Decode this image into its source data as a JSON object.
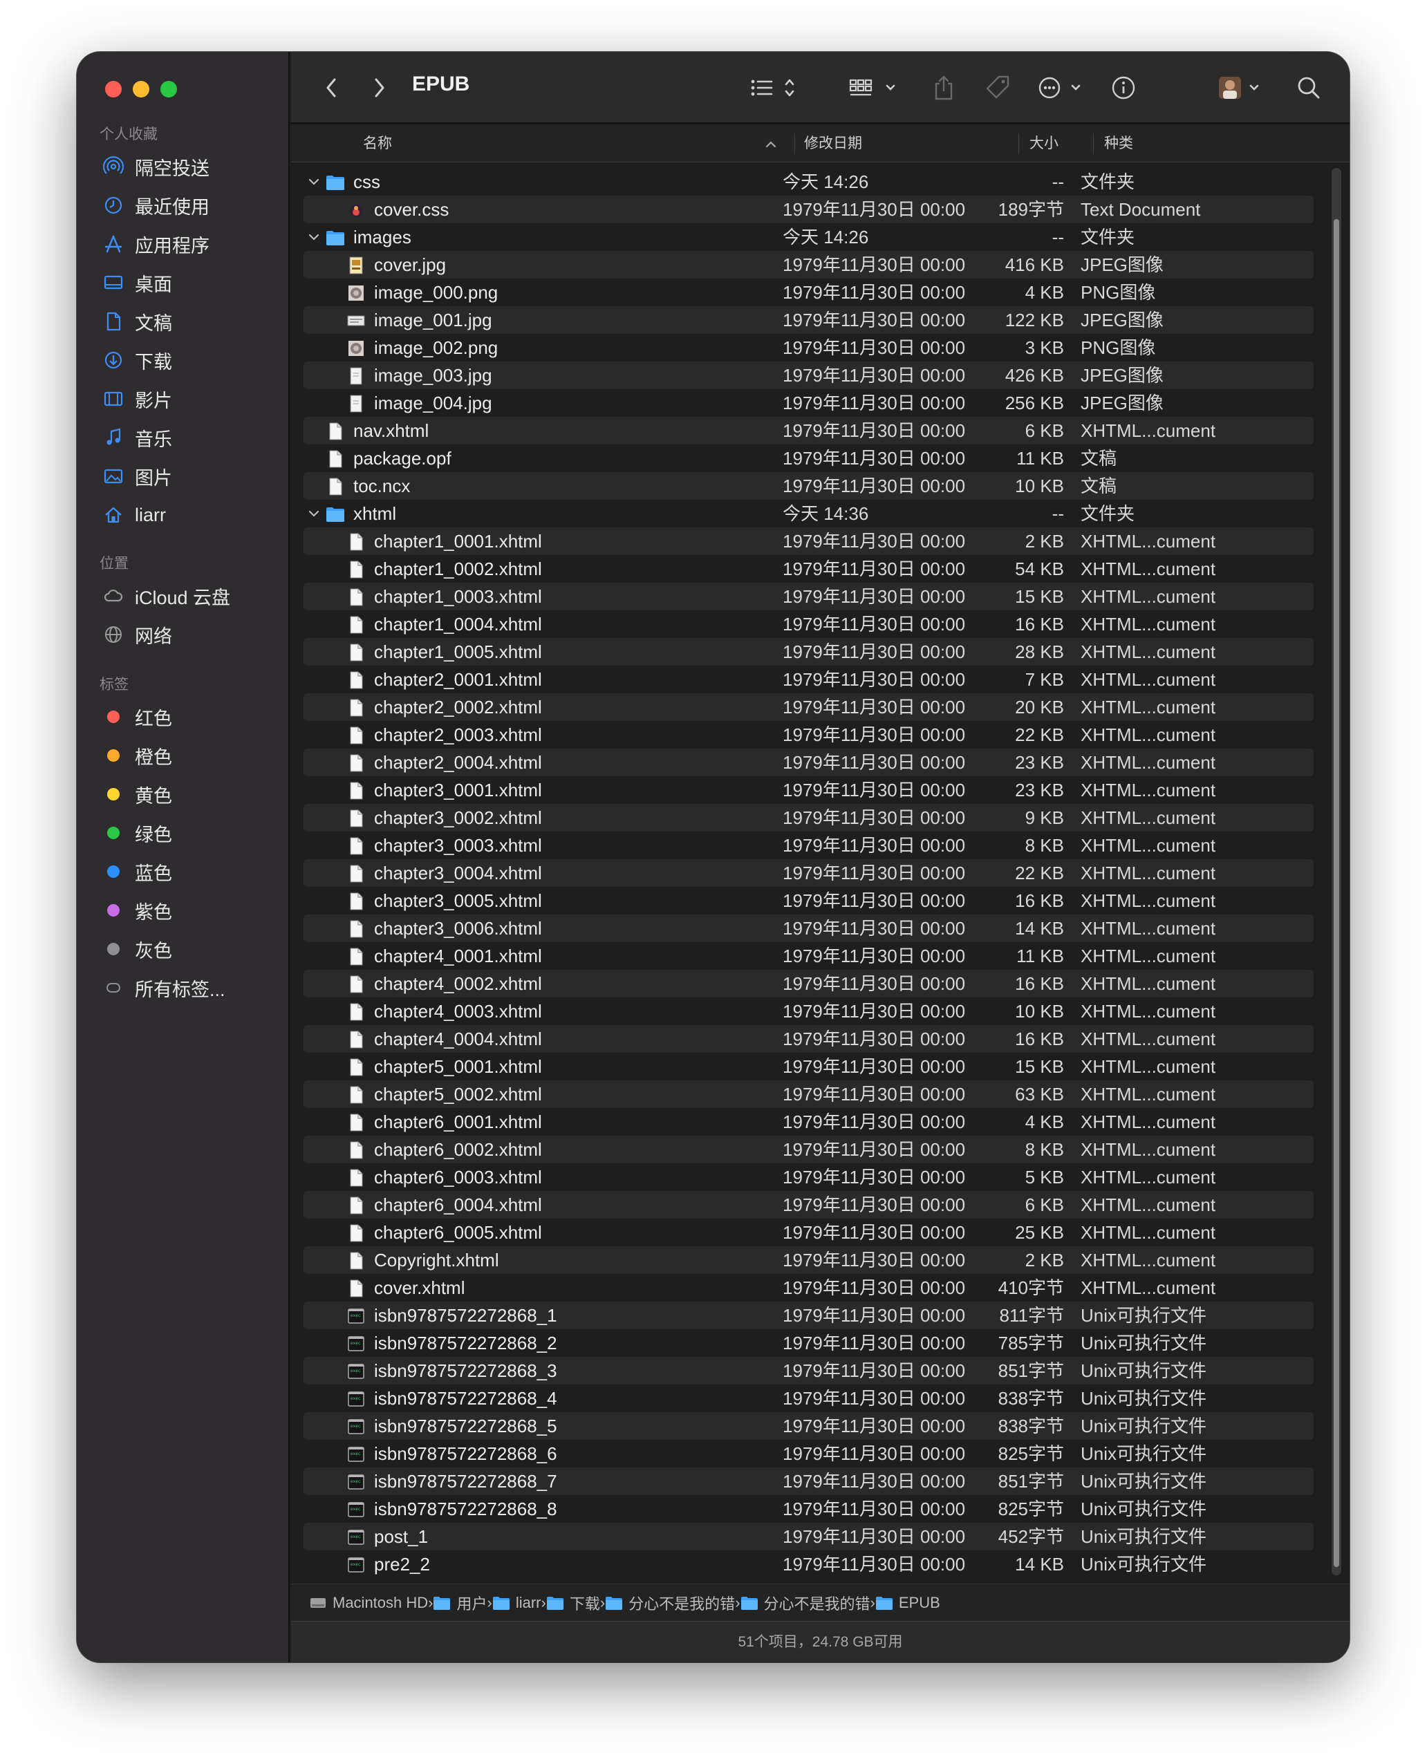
{
  "window_title": "EPUB",
  "sidebar": {
    "favorites_header": "个人收藏",
    "favorites": [
      {
        "label": "隔空投送",
        "icon": "airdrop-icon"
      },
      {
        "label": "最近使用",
        "icon": "clock-icon"
      },
      {
        "label": "应用程序",
        "icon": "applications-icon"
      },
      {
        "label": "桌面",
        "icon": "desktop-icon"
      },
      {
        "label": "文稿",
        "icon": "document-icon"
      },
      {
        "label": "下载",
        "icon": "download-icon"
      },
      {
        "label": "影片",
        "icon": "film-icon"
      },
      {
        "label": "音乐",
        "icon": "music-icon"
      },
      {
        "label": "图片",
        "icon": "photo-icon"
      },
      {
        "label": "liarr",
        "icon": "home-icon"
      }
    ],
    "locations_header": "位置",
    "locations": [
      {
        "label": "iCloud 云盘",
        "icon": "icloud-icon"
      },
      {
        "label": "网络",
        "icon": "network-icon"
      }
    ],
    "tags_header": "标签",
    "tags": [
      {
        "label": "红色",
        "color": "#fe5f57"
      },
      {
        "label": "橙色",
        "color": "#fdaa2c"
      },
      {
        "label": "黄色",
        "color": "#fdd62f"
      },
      {
        "label": "绿色",
        "color": "#2ac846"
      },
      {
        "label": "蓝色",
        "color": "#2d8fff"
      },
      {
        "label": "紫色",
        "color": "#c86ce8"
      },
      {
        "label": "灰色",
        "color": "#8e8e93"
      },
      {
        "label": "所有标签...",
        "color": ""
      }
    ]
  },
  "columns": {
    "name": "名称",
    "date": "修改日期",
    "size": "大小",
    "kind": "种类"
  },
  "files": [
    {
      "name": "css",
      "date": "今天 14:26",
      "size": "--",
      "kind": "文件夹",
      "level": 0,
      "icon": "folder-icon",
      "expanded": true
    },
    {
      "name": "cover.css",
      "date": "1979年11月30日 00:00",
      "size": "189字节",
      "kind": "Text Document",
      "level": 1,
      "icon": "css-file-icon"
    },
    {
      "name": "images",
      "date": "今天 14:26",
      "size": "--",
      "kind": "文件夹",
      "level": 0,
      "icon": "folder-icon",
      "expanded": true
    },
    {
      "name": "cover.jpg",
      "date": "1979年11月30日 00:00",
      "size": "416 KB",
      "kind": "JPEG图像",
      "level": 1,
      "icon": "image-thumb-icon"
    },
    {
      "name": "image_000.png",
      "date": "1979年11月30日 00:00",
      "size": "4 KB",
      "kind": "PNG图像",
      "level": 1,
      "icon": "image-thumb-icon"
    },
    {
      "name": "image_001.jpg",
      "date": "1979年11月30日 00:00",
      "size": "122 KB",
      "kind": "JPEG图像",
      "level": 1,
      "icon": "image-thumb-icon"
    },
    {
      "name": "image_002.png",
      "date": "1979年11月30日 00:00",
      "size": "3 KB",
      "kind": "PNG图像",
      "level": 1,
      "icon": "image-thumb-icon"
    },
    {
      "name": "image_003.jpg",
      "date": "1979年11月30日 00:00",
      "size": "426 KB",
      "kind": "JPEG图像",
      "level": 1,
      "icon": "image-thumb-icon"
    },
    {
      "name": "image_004.jpg",
      "date": "1979年11月30日 00:00",
      "size": "256 KB",
      "kind": "JPEG图像",
      "level": 1,
      "icon": "image-thumb-icon"
    },
    {
      "name": "nav.xhtml",
      "date": "1979年11月30日 00:00",
      "size": "6 KB",
      "kind": "XHTML...cument",
      "level": 0,
      "icon": "document-file-icon"
    },
    {
      "name": "package.opf",
      "date": "1979年11月30日 00:00",
      "size": "11 KB",
      "kind": "文稿",
      "level": 0,
      "icon": "document-file-icon"
    },
    {
      "name": "toc.ncx",
      "date": "1979年11月30日 00:00",
      "size": "10 KB",
      "kind": "文稿",
      "level": 0,
      "icon": "document-file-icon"
    },
    {
      "name": "xhtml",
      "date": "今天 14:36",
      "size": "--",
      "kind": "文件夹",
      "level": 0,
      "icon": "folder-icon",
      "expanded": true
    },
    {
      "name": "chapter1_0001.xhtml",
      "date": "1979年11月30日 00:00",
      "size": "2 KB",
      "kind": "XHTML...cument",
      "level": 1,
      "icon": "document-file-icon"
    },
    {
      "name": "chapter1_0002.xhtml",
      "date": "1979年11月30日 00:00",
      "size": "54 KB",
      "kind": "XHTML...cument",
      "level": 1,
      "icon": "document-file-icon"
    },
    {
      "name": "chapter1_0003.xhtml",
      "date": "1979年11月30日 00:00",
      "size": "15 KB",
      "kind": "XHTML...cument",
      "level": 1,
      "icon": "document-file-icon"
    },
    {
      "name": "chapter1_0004.xhtml",
      "date": "1979年11月30日 00:00",
      "size": "16 KB",
      "kind": "XHTML...cument",
      "level": 1,
      "icon": "document-file-icon"
    },
    {
      "name": "chapter1_0005.xhtml",
      "date": "1979年11月30日 00:00",
      "size": "28 KB",
      "kind": "XHTML...cument",
      "level": 1,
      "icon": "document-file-icon"
    },
    {
      "name": "chapter2_0001.xhtml",
      "date": "1979年11月30日 00:00",
      "size": "7 KB",
      "kind": "XHTML...cument",
      "level": 1,
      "icon": "document-file-icon"
    },
    {
      "name": "chapter2_0002.xhtml",
      "date": "1979年11月30日 00:00",
      "size": "20 KB",
      "kind": "XHTML...cument",
      "level": 1,
      "icon": "document-file-icon"
    },
    {
      "name": "chapter2_0003.xhtml",
      "date": "1979年11月30日 00:00",
      "size": "22 KB",
      "kind": "XHTML...cument",
      "level": 1,
      "icon": "document-file-icon"
    },
    {
      "name": "chapter2_0004.xhtml",
      "date": "1979年11月30日 00:00",
      "size": "23 KB",
      "kind": "XHTML...cument",
      "level": 1,
      "icon": "document-file-icon"
    },
    {
      "name": "chapter3_0001.xhtml",
      "date": "1979年11月30日 00:00",
      "size": "23 KB",
      "kind": "XHTML...cument",
      "level": 1,
      "icon": "document-file-icon"
    },
    {
      "name": "chapter3_0002.xhtml",
      "date": "1979年11月30日 00:00",
      "size": "9 KB",
      "kind": "XHTML...cument",
      "level": 1,
      "icon": "document-file-icon"
    },
    {
      "name": "chapter3_0003.xhtml",
      "date": "1979年11月30日 00:00",
      "size": "8 KB",
      "kind": "XHTML...cument",
      "level": 1,
      "icon": "document-file-icon"
    },
    {
      "name": "chapter3_0004.xhtml",
      "date": "1979年11月30日 00:00",
      "size": "22 KB",
      "kind": "XHTML...cument",
      "level": 1,
      "icon": "document-file-icon"
    },
    {
      "name": "chapter3_0005.xhtml",
      "date": "1979年11月30日 00:00",
      "size": "16 KB",
      "kind": "XHTML...cument",
      "level": 1,
      "icon": "document-file-icon"
    },
    {
      "name": "chapter3_0006.xhtml",
      "date": "1979年11月30日 00:00",
      "size": "14 KB",
      "kind": "XHTML...cument",
      "level": 1,
      "icon": "document-file-icon"
    },
    {
      "name": "chapter4_0001.xhtml",
      "date": "1979年11月30日 00:00",
      "size": "11 KB",
      "kind": "XHTML...cument",
      "level": 1,
      "icon": "document-file-icon"
    },
    {
      "name": "chapter4_0002.xhtml",
      "date": "1979年11月30日 00:00",
      "size": "16 KB",
      "kind": "XHTML...cument",
      "level": 1,
      "icon": "document-file-icon"
    },
    {
      "name": "chapter4_0003.xhtml",
      "date": "1979年11月30日 00:00",
      "size": "10 KB",
      "kind": "XHTML...cument",
      "level": 1,
      "icon": "document-file-icon"
    },
    {
      "name": "chapter4_0004.xhtml",
      "date": "1979年11月30日 00:00",
      "size": "16 KB",
      "kind": "XHTML...cument",
      "level": 1,
      "icon": "document-file-icon"
    },
    {
      "name": "chapter5_0001.xhtml",
      "date": "1979年11月30日 00:00",
      "size": "15 KB",
      "kind": "XHTML...cument",
      "level": 1,
      "icon": "document-file-icon"
    },
    {
      "name": "chapter5_0002.xhtml",
      "date": "1979年11月30日 00:00",
      "size": "63 KB",
      "kind": "XHTML...cument",
      "level": 1,
      "icon": "document-file-icon"
    },
    {
      "name": "chapter6_0001.xhtml",
      "date": "1979年11月30日 00:00",
      "size": "4 KB",
      "kind": "XHTML...cument",
      "level": 1,
      "icon": "document-file-icon"
    },
    {
      "name": "chapter6_0002.xhtml",
      "date": "1979年11月30日 00:00",
      "size": "8 KB",
      "kind": "XHTML...cument",
      "level": 1,
      "icon": "document-file-icon"
    },
    {
      "name": "chapter6_0003.xhtml",
      "date": "1979年11月30日 00:00",
      "size": "5 KB",
      "kind": "XHTML...cument",
      "level": 1,
      "icon": "document-file-icon"
    },
    {
      "name": "chapter6_0004.xhtml",
      "date": "1979年11月30日 00:00",
      "size": "6 KB",
      "kind": "XHTML...cument",
      "level": 1,
      "icon": "document-file-icon"
    },
    {
      "name": "chapter6_0005.xhtml",
      "date": "1979年11月30日 00:00",
      "size": "25 KB",
      "kind": "XHTML...cument",
      "level": 1,
      "icon": "document-file-icon"
    },
    {
      "name": "Copyright.xhtml",
      "date": "1979年11月30日 00:00",
      "size": "2 KB",
      "kind": "XHTML...cument",
      "level": 1,
      "icon": "document-file-icon"
    },
    {
      "name": "cover.xhtml",
      "date": "1979年11月30日 00:00",
      "size": "410字节",
      "kind": "XHTML...cument",
      "level": 1,
      "icon": "document-file-icon"
    },
    {
      "name": "isbn9787572272868_1",
      "date": "1979年11月30日 00:00",
      "size": "811字节",
      "kind": "Unix可执行文件",
      "level": 1,
      "icon": "terminal-file-icon"
    },
    {
      "name": "isbn9787572272868_2",
      "date": "1979年11月30日 00:00",
      "size": "785字节",
      "kind": "Unix可执行文件",
      "level": 1,
      "icon": "terminal-file-icon"
    },
    {
      "name": "isbn9787572272868_3",
      "date": "1979年11月30日 00:00",
      "size": "851字节",
      "kind": "Unix可执行文件",
      "level": 1,
      "icon": "terminal-file-icon"
    },
    {
      "name": "isbn9787572272868_4",
      "date": "1979年11月30日 00:00",
      "size": "838字节",
      "kind": "Unix可执行文件",
      "level": 1,
      "icon": "terminal-file-icon"
    },
    {
      "name": "isbn9787572272868_5",
      "date": "1979年11月30日 00:00",
      "size": "838字节",
      "kind": "Unix可执行文件",
      "level": 1,
      "icon": "terminal-file-icon"
    },
    {
      "name": "isbn9787572272868_6",
      "date": "1979年11月30日 00:00",
      "size": "825字节",
      "kind": "Unix可执行文件",
      "level": 1,
      "icon": "terminal-file-icon"
    },
    {
      "name": "isbn9787572272868_7",
      "date": "1979年11月30日 00:00",
      "size": "851字节",
      "kind": "Unix可执行文件",
      "level": 1,
      "icon": "terminal-file-icon"
    },
    {
      "name": "isbn9787572272868_8",
      "date": "1979年11月30日 00:00",
      "size": "825字节",
      "kind": "Unix可执行文件",
      "level": 1,
      "icon": "terminal-file-icon"
    },
    {
      "name": "post_1",
      "date": "1979年11月30日 00:00",
      "size": "452字节",
      "kind": "Unix可执行文件",
      "level": 1,
      "icon": "terminal-file-icon"
    },
    {
      "name": "pre2_2",
      "date": "1979年11月30日 00:00",
      "size": "14 KB",
      "kind": "Unix可执行文件",
      "level": 1,
      "icon": "terminal-file-icon"
    }
  ],
  "path": [
    {
      "label": "Macintosh HD",
      "icon": "disk-icon"
    },
    {
      "label": "用户",
      "icon": "folder-icon"
    },
    {
      "label": "liarr",
      "icon": "folder-icon"
    },
    {
      "label": "下载",
      "icon": "folder-icon"
    },
    {
      "label": "分心不是我的错",
      "icon": "folder-icon"
    },
    {
      "label": "分心不是我的错",
      "icon": "folder-icon"
    },
    {
      "label": "EPUB",
      "icon": "folder-icon"
    }
  ],
  "status": "51个项目，24.78 GB可用"
}
